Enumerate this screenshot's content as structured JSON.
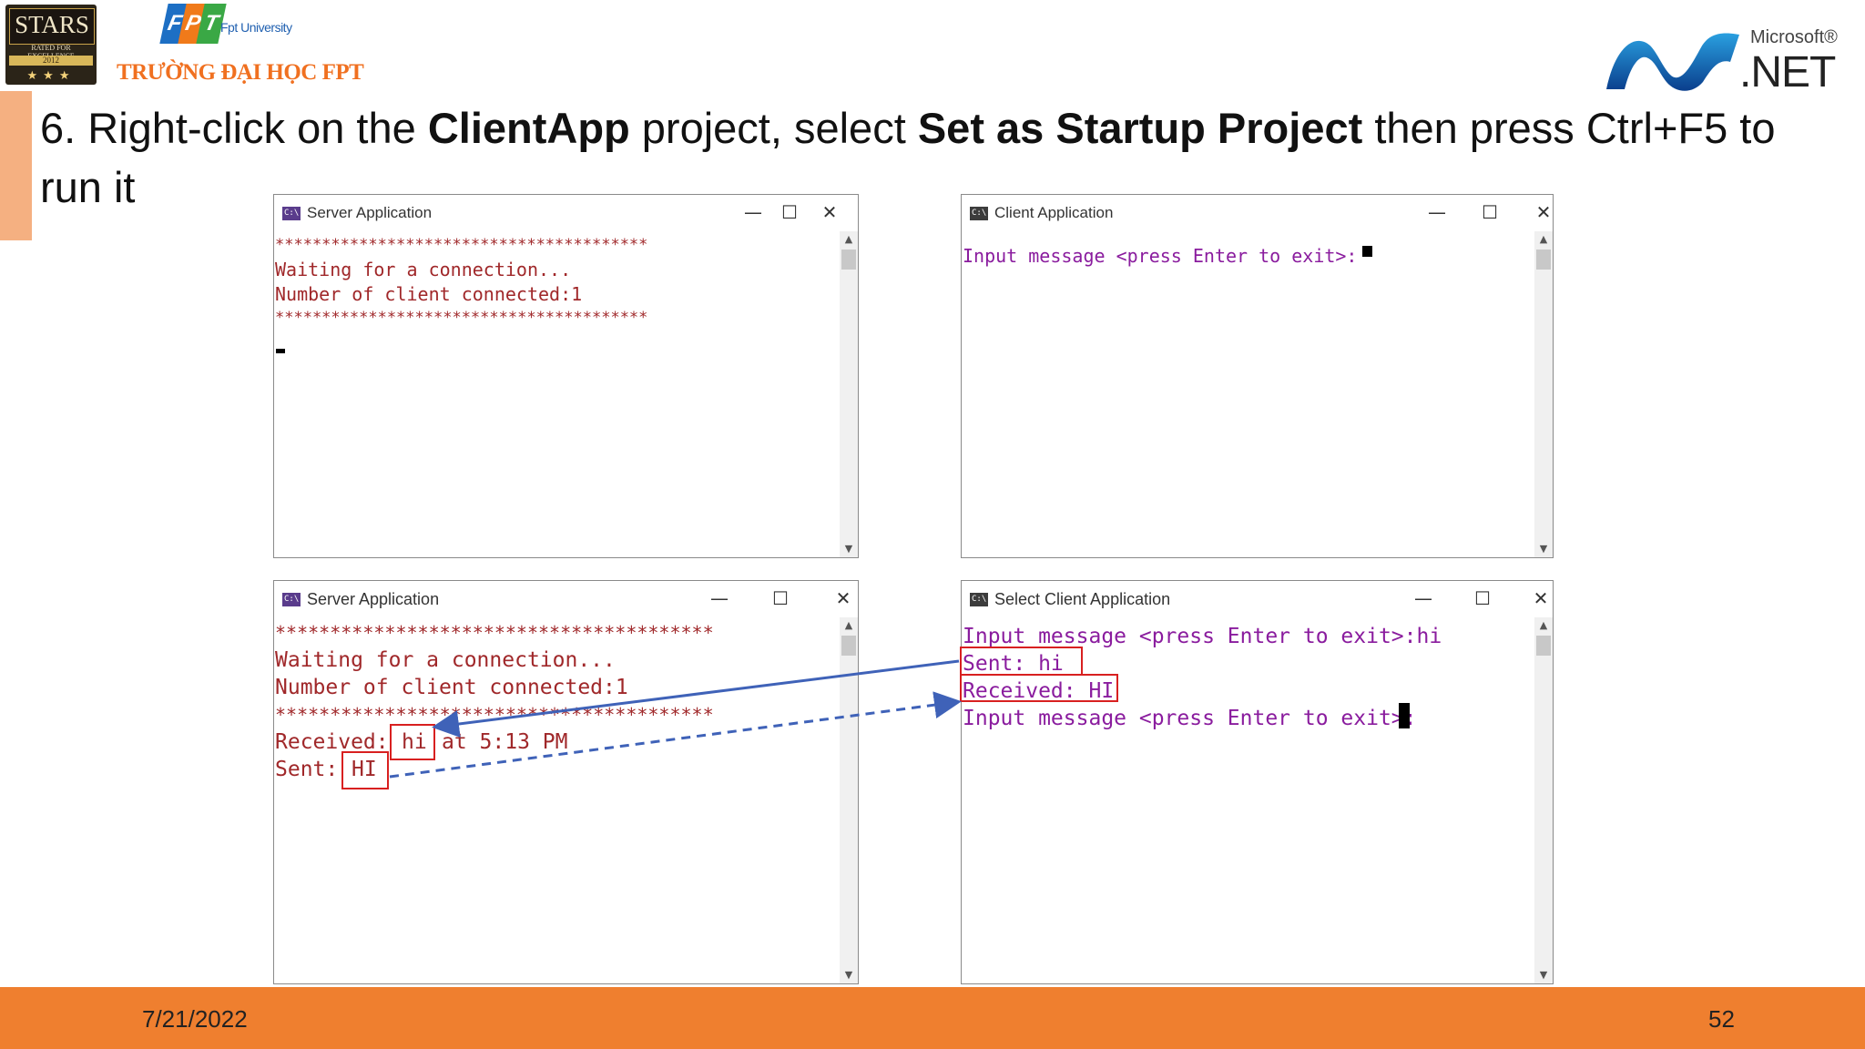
{
  "header": {
    "stars_logo": {
      "top": "STARS",
      "sub": "RATED FOR EXCELLENCE",
      "year": "2012",
      "stars": "★★★"
    },
    "fpt_letters": [
      "F",
      "P",
      "T"
    ],
    "fpt_university": "Fpt University",
    "university_name": "TRƯỜNG ĐẠI HỌC FPT",
    "net_logo": {
      "brand": "Microsoft®",
      "product": ".NET"
    }
  },
  "slide": {
    "title_parts": [
      "6. Right-click on the ",
      "ClientApp",
      " project, select ",
      "Set as Startup Project",
      " then press Ctrl+F5 to run it"
    ]
  },
  "windows": {
    "server1": {
      "title": "Server Application",
      "lines": [
        "****************************************",
        "Waiting for a connection...",
        "Number of client connected:1",
        "****************************************"
      ]
    },
    "client1": {
      "title": "Client Application",
      "lines": [
        "Input message <press Enter to exit>:"
      ]
    },
    "server2": {
      "title": "Server Application",
      "lines": [
        "****************************************",
        "Waiting for a connection...",
        "Number of client connected:1",
        "****************************************"
      ],
      "received_label": "Received:",
      "received_value": "hi",
      "received_time": "at 5:13 PM",
      "sent_label": "Sent:",
      "sent_value": "HI"
    },
    "client2": {
      "title": "Select Client Application",
      "lines": [
        "Input message <press Enter to exit>:hi",
        "Sent: hi",
        "Received: HI",
        "Input message <press Enter to exit>:"
      ]
    },
    "controls": {
      "minimize": "—",
      "maximize": "☐",
      "close": "✕"
    }
  },
  "footer": {
    "date": "7/21/2022",
    "page": "52"
  },
  "colors": {
    "footer": "#ef7f2f",
    "accent": "#f5b081",
    "server_text": "#a0282a",
    "client_text": "#8a1c9e",
    "highlight": "#d82020",
    "arrow": "#3f62b8"
  }
}
